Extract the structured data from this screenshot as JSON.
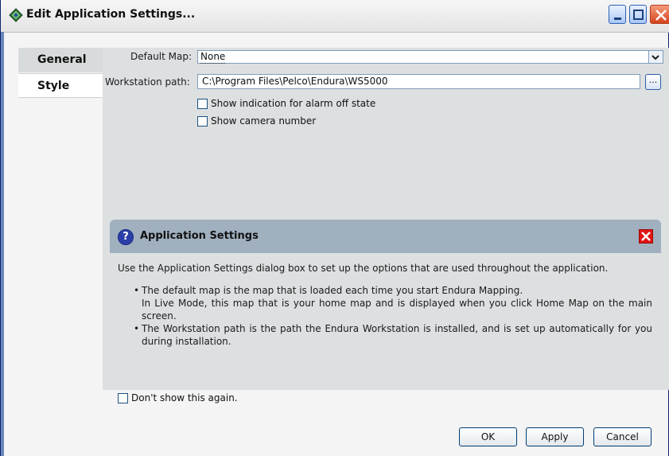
{
  "window": {
    "title": "Edit Application Settings..."
  },
  "tabs": [
    {
      "label": "General"
    },
    {
      "label": "Style"
    }
  ],
  "form": {
    "default_map_label": "Default Map:",
    "default_map_value": "None",
    "workstation_path_label": "Workstation path:",
    "workstation_path_value": "C:\\Program Files\\Pelco\\Endura\\WS5000",
    "browse_label": "...",
    "show_alarm_off_label": "Show indication for alarm off state",
    "show_camera_number_label": "Show camera number"
  },
  "help": {
    "title": "Application Settings",
    "intro": "Use the Application Settings dialog box to set up the options that are used throughout the application.",
    "bullet1_line1": "The default map is the map that is loaded each time you start Endura Mapping.",
    "bullet1_line2": "In Live Mode, this map that is your home map and is displayed when you click Home Map on the main screen.",
    "bullet2": "The Workstation path is the path the Endura Workstation is installed, and is set up automatically for you during installation.",
    "dont_show_label": "Don't show this again."
  },
  "buttons": {
    "ok": "OK",
    "apply": "Apply",
    "cancel": "Cancel"
  },
  "icons": {
    "app": "diamond-app-icon",
    "help": "question-icon",
    "close": "close-icon"
  },
  "colors": {
    "help_header": "#a0b0bf",
    "close_red": "#e01414",
    "panel_bg": "#dde0e1"
  }
}
